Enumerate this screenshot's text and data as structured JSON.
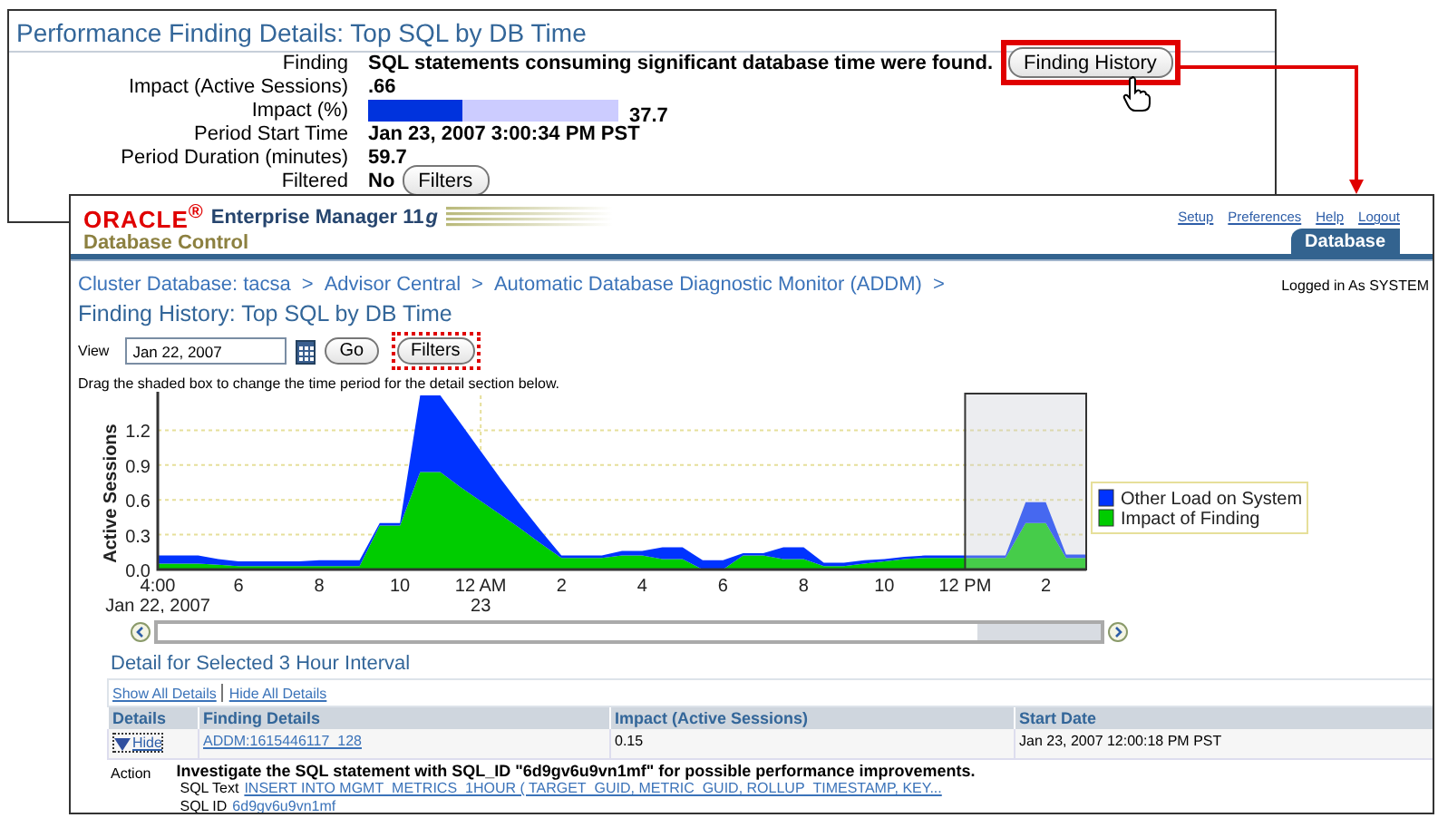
{
  "finding_panel": {
    "title": "Performance Finding Details: Top SQL by DB Time",
    "fields": [
      {
        "kind": "text",
        "label": "Finding",
        "value": "SQL statements consuming significant database time were found.",
        "button": "Finding History"
      },
      {
        "kind": "text",
        "label": "Impact (Active Sessions)",
        "value": ".66"
      },
      {
        "kind": "meter",
        "label": "Impact (%)",
        "level": 0.377,
        "value": "37.7"
      },
      {
        "kind": "text",
        "label": "Period Start Time",
        "value": "Jan 23, 2007 3:00:34 PM PST"
      },
      {
        "kind": "text",
        "label": "Period Duration (minutes)",
        "value": "59.7"
      },
      {
        "kind": "text",
        "label": "Filtered",
        "value": "No",
        "button": "Filters"
      }
    ]
  },
  "em_window": {
    "brand": "ORACLE$^{®}$",
    "product": "Enterprise Manager 11",
    "product_suffix": "g",
    "subtitle": "Database Control",
    "global_links": [
      "Setup",
      "Preferences",
      "Help",
      "Logout"
    ],
    "tabs": [
      {
        "label": "Database",
        "selected": true
      }
    ],
    "breadcrumbs": [
      {
        "label": "Cluster Database: tacsa",
        "separator": ">"
      },
      {
        "label": "Advisor Central",
        "separator": ">"
      },
      {
        "label": "Automatic Database Diagnostic Monitor (ADDM)",
        "separator": ">"
      }
    ],
    "logged_in": "Logged in As SYSTEM",
    "page_title": "Finding History: Top SQL by DB Time",
    "view": {
      "label": "View",
      "date": "Jan 22, 2007",
      "go": "Go",
      "filters": "Filters"
    },
    "instruction": "Drag the shaded box to change the time period for the detail section below.",
    "chart_data": {
      "type": "area",
      "stacked": true,
      "grid": true,
      "legend": true,
      "ylabel": "Active Sessions",
      "ylim": [
        0,
        1.5
      ],
      "categories": [
        "4:00\nJan 22, 2007",
        null,
        null,
        null,
        "6",
        null,
        null,
        null,
        "8",
        null,
        null,
        null,
        "10",
        null,
        null,
        null,
        "12 AM\n23",
        null,
        null,
        null,
        "2",
        null,
        null,
        null,
        "4",
        null,
        null,
        null,
        "6",
        null,
        null,
        null,
        "8",
        null,
        null,
        null,
        "10",
        null,
        null,
        null,
        "12 PM",
        null,
        null,
        null,
        "2",
        null,
        null
      ],
      "series": [
        {
          "name": "Impact of Finding",
          "color": "#00cc00",
          "values": [
            0.05,
            0.05,
            0.05,
            0.04,
            0.03,
            0.03,
            0.03,
            0.03,
            0.03,
            0.03,
            0.03,
            0.38,
            0.38,
            0.84,
            0.84,
            0.71,
            0.59,
            0.47,
            0.35,
            0.22,
            0.1,
            0.1,
            0.1,
            0.12,
            0.12,
            0.09,
            0.09,
            0,
            0,
            0.12,
            0.12,
            0.09,
            0.09,
            0.03,
            0.03,
            0.05,
            0.07,
            0.09,
            0.1,
            0.1,
            0.1,
            0.1,
            0.1,
            0.4,
            0.4,
            0.1,
            0.1
          ]
        },
        {
          "name": "Other Load on System",
          "color": "#0033ff",
          "values": [
            0.07,
            0.07,
            0.07,
            0.05,
            0.04,
            0.04,
            0.04,
            0.04,
            0.05,
            0.05,
            0.05,
            0.02,
            0.02,
            0.66,
            0.66,
            0.55,
            0.43,
            0.31,
            0.2,
            0.11,
            0.02,
            0.02,
            0.02,
            0.04,
            0.04,
            0.1,
            0.1,
            0.08,
            0.08,
            0.02,
            0.02,
            0.1,
            0.1,
            0.03,
            0.03,
            0.03,
            0.02,
            0.02,
            0.02,
            0.02,
            0.02,
            0.02,
            0.02,
            0.18,
            0.18,
            0.03,
            0.03
          ]
        }
      ],
      "yticks": [
        {
          "value": 0,
          "label": "0.0"
        },
        {
          "value": 0.3,
          "label": "0.3"
        },
        {
          "value": 0.6,
          "label": "0.6"
        },
        {
          "value": 0.9,
          "label": "0.9"
        },
        {
          "value": 1.2,
          "label": "1.2"
        }
      ]
    },
    "detail": {
      "title": "Detail for Selected 3 Hour Interval",
      "links": [
        "Show All Details",
        "Hide All Details"
      ],
      "table": {
        "columns": [
          "Details",
          "Finding Details",
          "Impact (Active Sessions)",
          "Start Date"
        ],
        "rows": [
          {
            "details": "Hide",
            "expanded": true,
            "finding": "ADDM:1615446117_128",
            "impact": "0.15",
            "start_date": "Jan 23, 2007 12:00:18 PM PST"
          }
        ]
      },
      "action": {
        "label": "Action",
        "text": "Investigate the SQL statement with SQL_ID \"6d9gv6u9vn1mf\" for possible performance improvements.",
        "sql_text_label": "SQL Text",
        "sql_text": "INSERT INTO MGMT_METRICS_1HOUR ( TARGET_GUID, METRIC_GUID, ROLLUP_TIMESTAMP, KEY...",
        "sql_id_label": "SQL ID",
        "sql_id": "6d9gv6u9vn1mf"
      }
    }
  }
}
